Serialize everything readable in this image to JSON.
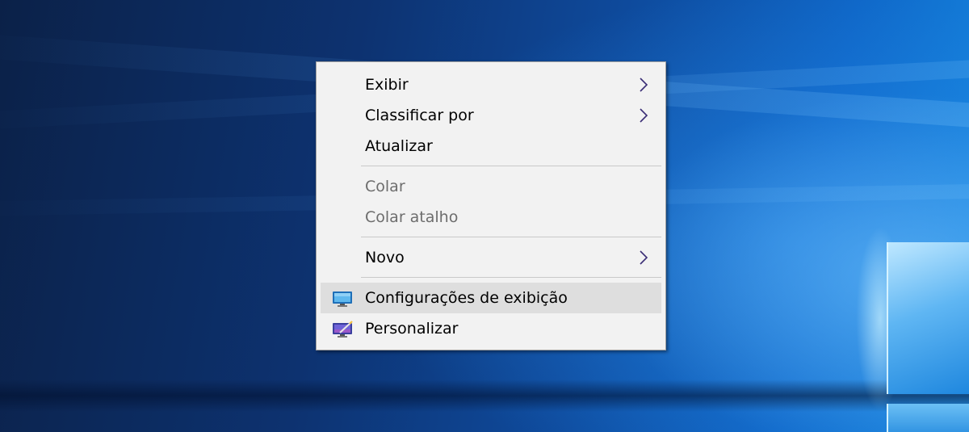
{
  "context_menu": {
    "items": [
      {
        "label": "Exibir",
        "has_submenu": true,
        "disabled": false
      },
      {
        "label": "Classificar por",
        "has_submenu": true,
        "disabled": false
      },
      {
        "label": "Atualizar",
        "has_submenu": false,
        "disabled": false
      },
      {
        "label": "Colar",
        "has_submenu": false,
        "disabled": true
      },
      {
        "label": "Colar atalho",
        "has_submenu": false,
        "disabled": true
      },
      {
        "label": "Novo",
        "has_submenu": true,
        "disabled": false
      },
      {
        "label": "Configurações de exibição",
        "icon": "display-settings-icon",
        "highlighted": true
      },
      {
        "label": "Personalizar",
        "icon": "personalize-icon"
      }
    ]
  },
  "colors": {
    "menu_background": "#f2f2f2",
    "highlight": "#dedede",
    "disabled_text": "#6d6d6d",
    "chevron": "#3a2d75"
  }
}
